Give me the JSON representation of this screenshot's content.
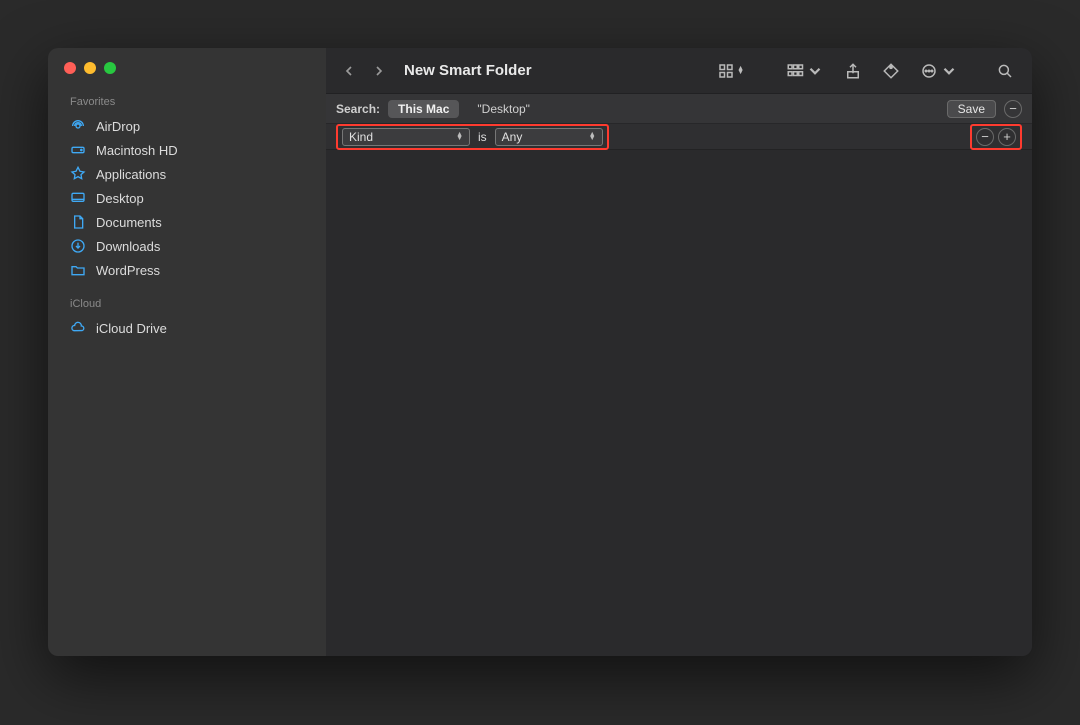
{
  "window": {
    "title": "New Smart Folder"
  },
  "sidebar": {
    "favorites_label": "Favorites",
    "items": [
      {
        "label": "AirDrop"
      },
      {
        "label": "Macintosh HD"
      },
      {
        "label": "Applications"
      },
      {
        "label": "Desktop"
      },
      {
        "label": "Documents"
      },
      {
        "label": "Downloads"
      },
      {
        "label": "WordPress"
      }
    ],
    "icloud_label": "iCloud",
    "icloud_items": [
      {
        "label": "iCloud Drive"
      }
    ]
  },
  "search": {
    "label": "Search:",
    "scope_this_mac": "This Mac",
    "scope_desktop": "\"Desktop\"",
    "save_label": "Save"
  },
  "criteria": {
    "attribute": "Kind",
    "operator": "is",
    "value": "Any"
  }
}
